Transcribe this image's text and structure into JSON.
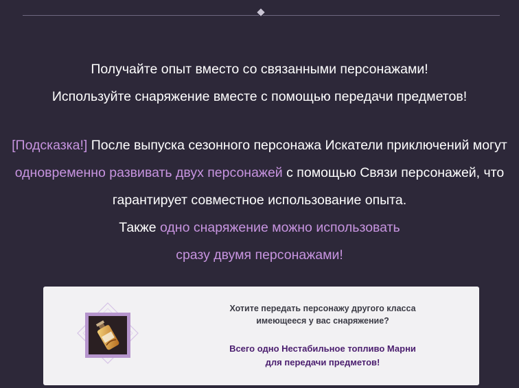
{
  "intro": {
    "line1": "Получайте опыт вместо со связанными персонажами!",
    "line2": "Используйте снаряжение вместе с помощью передачи предметов!"
  },
  "hint": {
    "tag": "[Подсказка!]",
    "line1_rest": " После выпуска сезонного персонажа Искатели приключений могут",
    "line2_accent": "одновременно развивать двух персонажей",
    "line2_rest": " с помощью Связи персонажей, что",
    "line3": "гарантирует совместное использование опыта.",
    "line4_prefix": "Также ",
    "line4_accent": "одно снаряжение можно использовать",
    "line5_accent": "сразу двумя персонажами!"
  },
  "panel": {
    "question_line1": "Хотите передать персонажу другого класса",
    "question_line2": "имеющееся у вас снаряжение?",
    "offer_line1": "Всего одно Нестабильное топливо Марни",
    "offer_line2": "для передачи предметов!",
    "item_icon": "fuel-bottle-icon"
  },
  "colors": {
    "background": "#2d2839",
    "accent": "#c794e0",
    "panel": "#f2f1f3",
    "offer_text": "#4a1d6e"
  }
}
